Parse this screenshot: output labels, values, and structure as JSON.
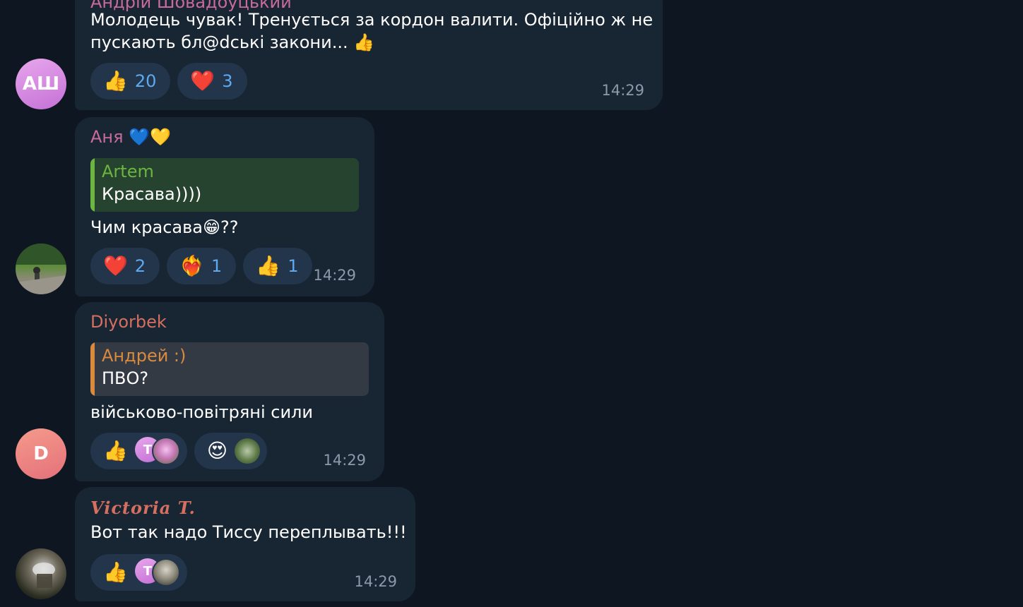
{
  "messages": [
    {
      "sender": "Андрій Шовадоуцький",
      "avatar_initials": "АШ",
      "text_line1": "Молодець чувак! Тренується за кордон валити. Офіційно ж не",
      "text_line2": "пускають бл@dські закони... 👍",
      "reactions": [
        {
          "emoji": "👍",
          "count": "20"
        },
        {
          "emoji": "❤️",
          "count": "3"
        }
      ],
      "time": "14:29"
    },
    {
      "sender": "Аня 💙💛",
      "quote_name": "Artem",
      "quote_text": "Красава))))",
      "text": "Чим красава😁??",
      "reactions": [
        {
          "emoji": "❤️",
          "count": "2"
        },
        {
          "emoji": "❤️‍🔥",
          "count": "1"
        },
        {
          "emoji": "👍",
          "count": "1"
        }
      ],
      "time": "14:29"
    },
    {
      "sender": "Diyorbek",
      "avatar_initials": "D",
      "quote_name": "Андрей :)",
      "quote_text": "ПВО?",
      "text": "військово-повітряні сили",
      "reactions": [
        {
          "emoji": "👍",
          "user_initial": "T"
        },
        {
          "emoji": "😍"
        }
      ],
      "time": "14:29"
    },
    {
      "sender": "Victoria T.",
      "text": "Вот так надо Тиссу переплывать!!!",
      "reactions": [
        {
          "emoji": "👍",
          "user_initial": "T"
        }
      ],
      "time": "14:29"
    }
  ],
  "colors": {
    "background": "#0e1621",
    "bubble": "#182533",
    "reaction_bg": "#22354a",
    "reaction_count": "#5ea9ef",
    "time": "#8b9aab",
    "sender_pink": "#c76b9c",
    "sender_orange": "#d56f5f",
    "quote_green": "#6cb540",
    "quote_orange": "#d98a3e"
  }
}
